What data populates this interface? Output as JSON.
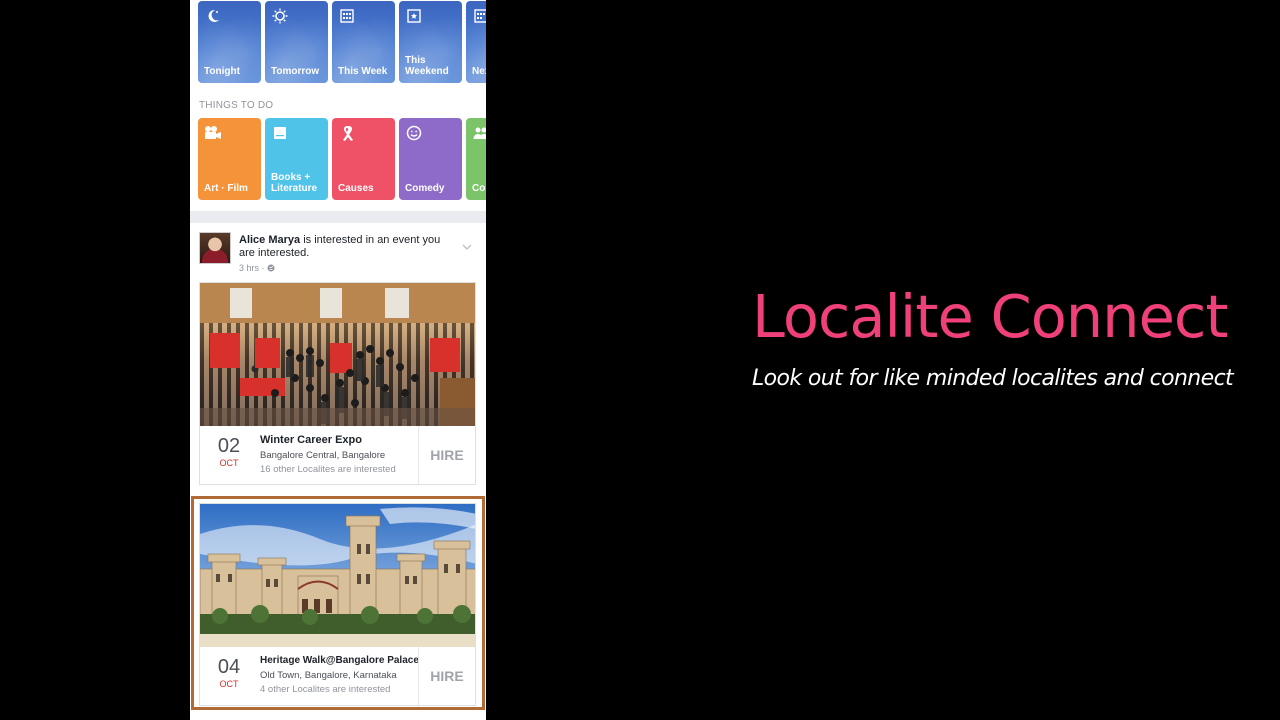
{
  "time_filters": [
    {
      "label": "Tonight",
      "icon": "moon-icon"
    },
    {
      "label": "Tomorrow",
      "icon": "sun-icon"
    },
    {
      "label": "This Week",
      "icon": "calendar-icon"
    },
    {
      "label": "This\nWeekend",
      "icon": "calendar-star-icon"
    },
    {
      "label": "Nex",
      "icon": "calendar-icon"
    }
  ],
  "things_to_do": {
    "heading": "THINGS TO DO",
    "categories": [
      {
        "label": "Art · Film",
        "icon": "film-camera-icon",
        "color": "#f4933a"
      },
      {
        "label": "Books +\nLiterature",
        "icon": "book-icon",
        "color": "#4fc3e8"
      },
      {
        "label": "Causes",
        "icon": "ribbon-icon",
        "color": "#ef5267"
      },
      {
        "label": "Comedy",
        "icon": "smiley-icon",
        "color": "#8e6bc8"
      },
      {
        "label": "Co",
        "icon": "people-icon",
        "color": "#7cc46a"
      }
    ]
  },
  "story": {
    "user_name": "Alice Marya",
    "text": " is interested in an event you are interested.",
    "time": "3 hrs · ",
    "privacy_icon": "globe-icon"
  },
  "events": [
    {
      "day": "02",
      "month": "OCT",
      "title": "Winter Career Expo",
      "location": "Bangalore Central, Bangalore",
      "interested": "16 other Localites are interested",
      "action": "HIRE"
    },
    {
      "day": "04",
      "month": "OCT",
      "title": "Heritage Walk@Bangalore Palace",
      "location": "Old Town, Bangalore, Karnataka",
      "interested": "4 other Localites are interested",
      "action": "HIRE"
    }
  ],
  "slide": {
    "headline": "Localite Connect",
    "subline": "Look out for like minded localites and connect",
    "headline_color": "#f0407a",
    "highlight_color": "#b06a35"
  }
}
